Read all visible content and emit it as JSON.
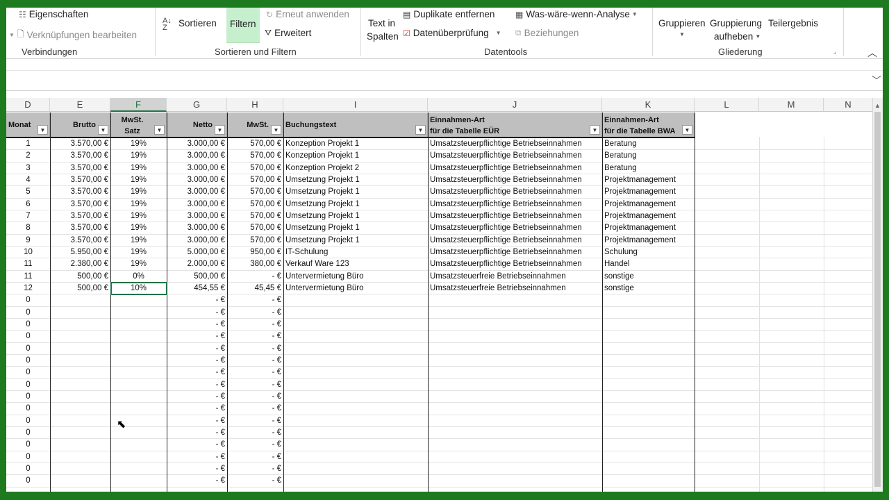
{
  "ribbon": {
    "verbindungen": {
      "eigenschaften": "Eigenschaften",
      "verknuepfungen": "Verknüpfungen bearbeiten",
      "label": "Verbindungen"
    },
    "sortieren_filtern": {
      "sortieren": "Sortieren",
      "filtern": "Filtern",
      "erneut": "Erneut anwenden",
      "erweitert": "Erweitert",
      "label": "Sortieren und Filtern"
    },
    "datentools": {
      "text_in": "Text in",
      "spalten": "Spalten",
      "duplikate": "Duplikate entfernen",
      "datenueberpruefung": "Datenüberprüfung",
      "was_waere": "Was-wäre-wenn-Analyse",
      "beziehungen": "Beziehungen",
      "label": "Datentools"
    },
    "gliederung": {
      "gruppieren": "Gruppieren",
      "gruppierung": "Gruppierung",
      "aufheben": "aufheben",
      "teilergebnis": "Teilergebnis",
      "label": "Gliederung"
    }
  },
  "columns": [
    "D",
    "E",
    "F",
    "G",
    "H",
    "I",
    "J",
    "K",
    "L",
    "M",
    "N"
  ],
  "headers": {
    "monat": "Monat",
    "brutto": "Brutto",
    "mwst_satz_1": "MwSt.",
    "mwst_satz_2": "Satz",
    "netto": "Netto",
    "mwst": "MwSt.",
    "buchungstext": "Buchungstext",
    "einnahmen_euer_1": "Einnahmen-Art",
    "einnahmen_euer_2": "für die Tabelle EÜR",
    "einnahmen_bwa_1": "Einnahmen-Art",
    "einnahmen_bwa_2": "für die Tabelle BWA"
  },
  "rows": [
    {
      "monat": "1",
      "brutto": "3.570,00 €",
      "satz": "19%",
      "netto": "3.000,00 €",
      "mwst": "570,00 €",
      "text": "Konzeption Projekt 1",
      "euer": "Umsatzsteuerpflichtige Betriebseinnahmen",
      "bwa": "Beratung"
    },
    {
      "monat": "2",
      "brutto": "3.570,00 €",
      "satz": "19%",
      "netto": "3.000,00 €",
      "mwst": "570,00 €",
      "text": "Konzeption Projekt 1",
      "euer": "Umsatzsteuerpflichtige Betriebseinnahmen",
      "bwa": "Beratung"
    },
    {
      "monat": "3",
      "brutto": "3.570,00 €",
      "satz": "19%",
      "netto": "3.000,00 €",
      "mwst": "570,00 €",
      "text": "Konzeption Projekt 2",
      "euer": "Umsatzsteuerpflichtige Betriebseinnahmen",
      "bwa": "Beratung"
    },
    {
      "monat": "4",
      "brutto": "3.570,00 €",
      "satz": "19%",
      "netto": "3.000,00 €",
      "mwst": "570,00 €",
      "text": "Umsetzung Projekt 1",
      "euer": "Umsatzsteuerpflichtige Betriebseinnahmen",
      "bwa": "Projektmanagement"
    },
    {
      "monat": "5",
      "brutto": "3.570,00 €",
      "satz": "19%",
      "netto": "3.000,00 €",
      "mwst": "570,00 €",
      "text": "Umsetzung Projekt 1",
      "euer": "Umsatzsteuerpflichtige Betriebseinnahmen",
      "bwa": "Projektmanagement"
    },
    {
      "monat": "6",
      "brutto": "3.570,00 €",
      "satz": "19%",
      "netto": "3.000,00 €",
      "mwst": "570,00 €",
      "text": "Umsetzung Projekt 1",
      "euer": "Umsatzsteuerpflichtige Betriebseinnahmen",
      "bwa": "Projektmanagement"
    },
    {
      "monat": "7",
      "brutto": "3.570,00 €",
      "satz": "19%",
      "netto": "3.000,00 €",
      "mwst": "570,00 €",
      "text": "Umsetzung Projekt 1",
      "euer": "Umsatzsteuerpflichtige Betriebseinnahmen",
      "bwa": "Projektmanagement"
    },
    {
      "monat": "8",
      "brutto": "3.570,00 €",
      "satz": "19%",
      "netto": "3.000,00 €",
      "mwst": "570,00 €",
      "text": "Umsetzung Projekt 1",
      "euer": "Umsatzsteuerpflichtige Betriebseinnahmen",
      "bwa": "Projektmanagement"
    },
    {
      "monat": "9",
      "brutto": "3.570,00 €",
      "satz": "19%",
      "netto": "3.000,00 €",
      "mwst": "570,00 €",
      "text": "Umsetzung Projekt 1",
      "euer": "Umsatzsteuerpflichtige Betriebseinnahmen",
      "bwa": "Projektmanagement"
    },
    {
      "monat": "10",
      "brutto": "5.950,00 €",
      "satz": "19%",
      "netto": "5.000,00 €",
      "mwst": "950,00 €",
      "text": "IT-Schulung",
      "euer": "Umsatzsteuerpflichtige Betriebseinnahmen",
      "bwa": "Schulung"
    },
    {
      "monat": "11",
      "brutto": "2.380,00 €",
      "satz": "19%",
      "netto": "2.000,00 €",
      "mwst": "380,00 €",
      "text": "Verkauf Ware 123",
      "euer": "Umsatzsteuerpflichtige Betriebseinnahmen",
      "bwa": "Handel"
    },
    {
      "monat": "11",
      "brutto": "500,00 €",
      "satz": "0%",
      "netto": "500,00 €",
      "mwst": "-   €",
      "text": "Untervermietung Büro",
      "euer": "Umsatzsteuerfreie Betriebseinnahmen",
      "bwa": "sonstige"
    },
    {
      "monat": "12",
      "brutto": "500,00 €",
      "satz": "10%",
      "netto": "454,55 €",
      "mwst": "45,45 €",
      "text": "Untervermietung Büro",
      "euer": "Umsatzsteuerfreie Betriebseinnahmen",
      "bwa": "sonstige"
    }
  ],
  "empty_row": {
    "monat": "0",
    "netto": "-   €",
    "mwst": "-   €"
  },
  "empty_row_count": 16
}
